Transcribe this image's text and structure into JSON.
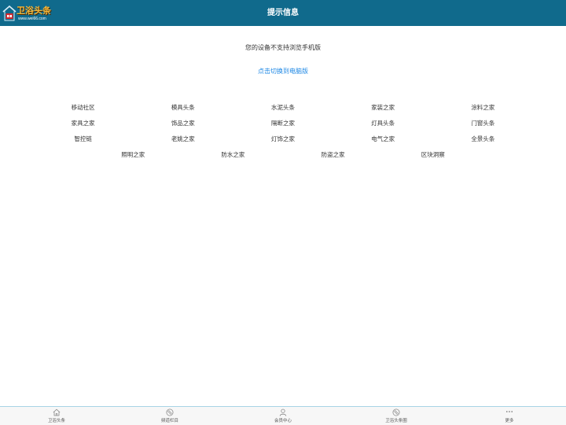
{
  "header": {
    "logo_title": "卫浴头条",
    "logo_url": "www.wei66.com",
    "title": "提示信息"
  },
  "notice": {
    "message": "您的设备不支持浏览手机版",
    "switch_link": "点击切换到电脑版"
  },
  "links": [
    "移动社区",
    "模具头条",
    "水泥头条",
    "家装之家",
    "涂料之家",
    "家具之家",
    "饰品之家",
    "隔断之家",
    "灯具头条",
    "门窗头条",
    "智控链",
    "老姚之家",
    "灯饰之家",
    "电气之家",
    "全景头条",
    "照明之家",
    "防水之家",
    "防盗之家",
    "区块洞察"
  ],
  "tabbar": [
    {
      "label": "卫浴头条",
      "icon": "home-icon"
    },
    {
      "label": "频道栏目",
      "icon": "channel-icon"
    },
    {
      "label": "会员中心",
      "icon": "user-icon"
    },
    {
      "label": "卫浴头条圈",
      "icon": "circle-icon"
    },
    {
      "label": "更多",
      "icon": "more-icon"
    }
  ],
  "colors": {
    "header_bg": "#106a8c",
    "link": "#1e88e5",
    "logo_text": "#f5b83a",
    "tabbar_border": "#a8d4e6"
  }
}
